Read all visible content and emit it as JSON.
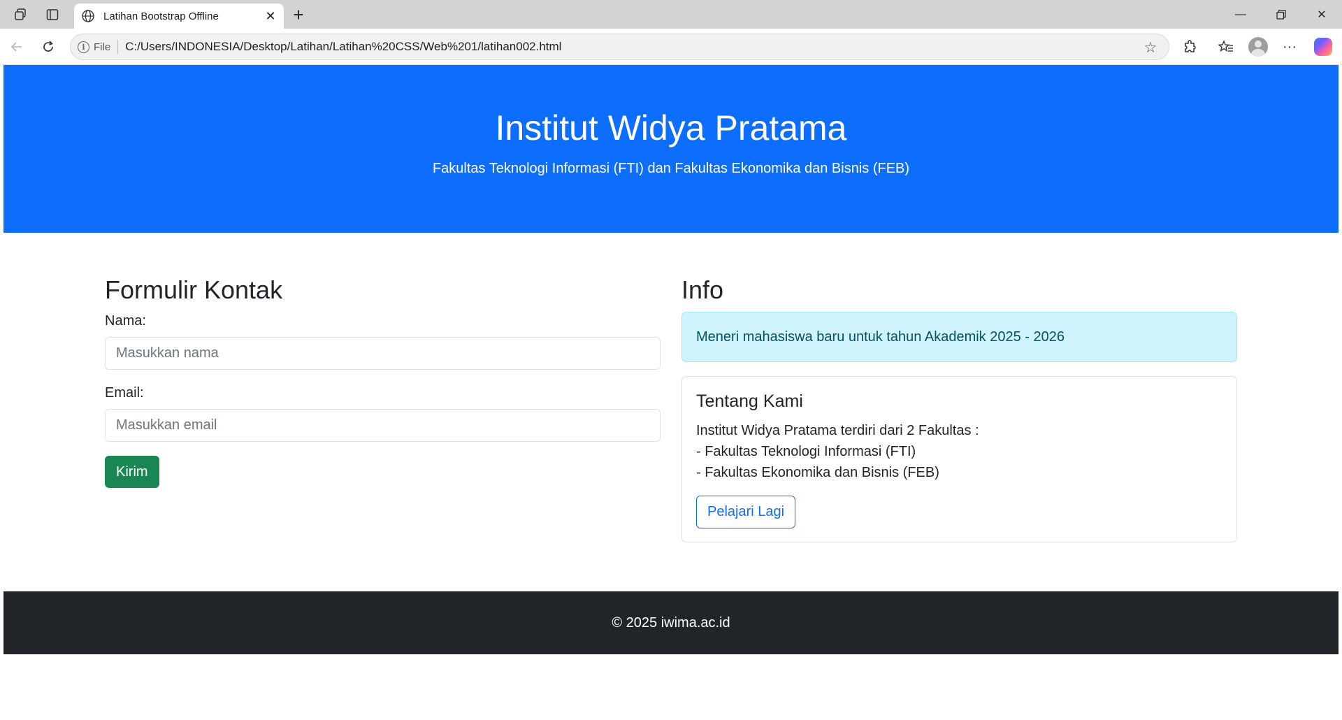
{
  "browser": {
    "tab_title": "Latihan Bootstrap Offline",
    "site_info_label": "File",
    "url": "C:/Users/INDONESIA/Desktop/Latihan/Latihan%20CSS/Web%201/latihan002.html"
  },
  "hero": {
    "title": "Institut Widya Pratama",
    "subtitle": "Fakultas Teknologi Informasi (FTI) dan Fakultas Ekonomika dan Bisnis (FEB)"
  },
  "contact_form": {
    "heading": "Formulir Kontak",
    "name_label": "Nama:",
    "name_placeholder": "Masukkan nama",
    "name_value": "",
    "email_label": "Email:",
    "email_placeholder": "Masukkan email",
    "email_value": "",
    "submit_label": "Kirim"
  },
  "info": {
    "heading": "Info",
    "alert_text": "Meneri mahasiswa baru untuk tahun Akademik 2025 - 2026",
    "card": {
      "title": "Tentang Kami",
      "lines": [
        "Institut Widya Pratama terdiri dari 2 Fakultas :",
        "- Fakultas Teknologi Informasi (FTI)",
        "- Fakultas Ekonomika dan Bisnis (FEB)"
      ],
      "button_label": "Pelajari Lagi"
    }
  },
  "footer": {
    "text": "© 2025 iwima.ac.id"
  },
  "colors": {
    "primary": "#0d6efd",
    "success": "#198754",
    "info_bg": "#cff4fc",
    "info_text": "#055160",
    "footer_bg": "#212529"
  },
  "icons": {
    "workspaces": "workspaces-icon",
    "tab_actions": "tab-actions-icon",
    "favicon": "globe-icon",
    "close": "close-icon",
    "new_tab": "plus-icon",
    "back": "back-arrow-icon",
    "refresh": "refresh-icon",
    "site_info": "info-icon",
    "favorite": "star-icon",
    "extensions": "puzzle-icon",
    "favorites": "favorites-icon",
    "profile": "profile-icon",
    "more": "more-icon",
    "copilot": "copilot-icon"
  }
}
